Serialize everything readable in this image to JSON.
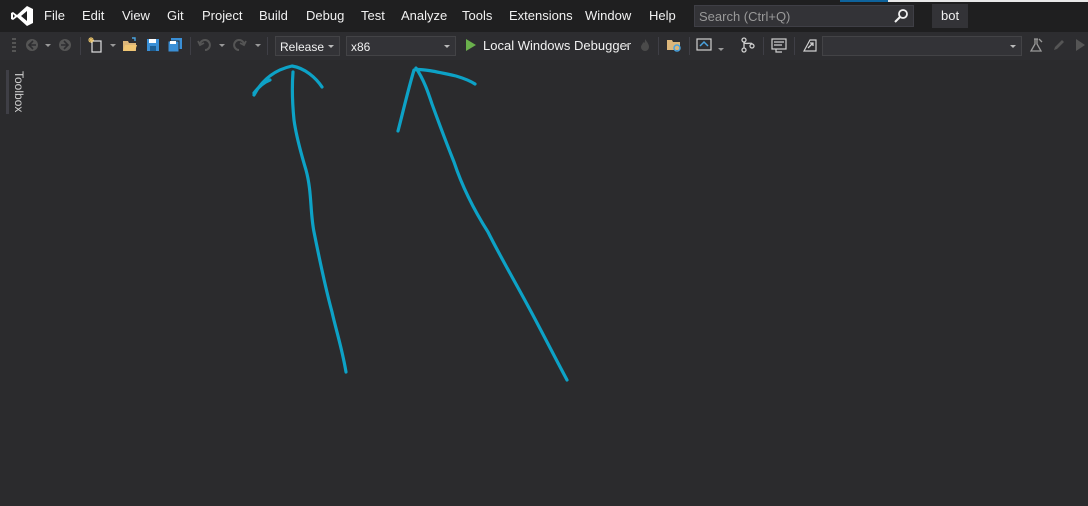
{
  "menu": {
    "items": [
      "File",
      "Edit",
      "View",
      "Git",
      "Project",
      "Build",
      "Debug",
      "Test",
      "Analyze",
      "Tools",
      "Extensions",
      "Window",
      "Help"
    ]
  },
  "search": {
    "placeholder": "Search (Ctrl+Q)"
  },
  "solution": {
    "name": "bot"
  },
  "toolbar": {
    "configuration": "Release",
    "platform": "x86",
    "start_debugger_label": "Local Windows Debugger",
    "target_combo": ""
  },
  "toolbox": {
    "label": "Toolbox"
  },
  "colors": {
    "annotation": "#0da2c6",
    "play": "#6ab04c",
    "background": "#2b2b2d"
  },
  "icons": [
    "visual-studio-logo",
    "back-icon",
    "forward-icon",
    "new-project-icon",
    "open-folder-icon",
    "save-icon",
    "save-all-icon",
    "undo-icon",
    "redo-icon",
    "play-icon",
    "fire-icon",
    "browse-folder-icon",
    "live-share-icon",
    "git-icon",
    "console-icon",
    "publish-icon",
    "flask-icon",
    "pencil-icon",
    "play-small-icon",
    "search-icon"
  ]
}
